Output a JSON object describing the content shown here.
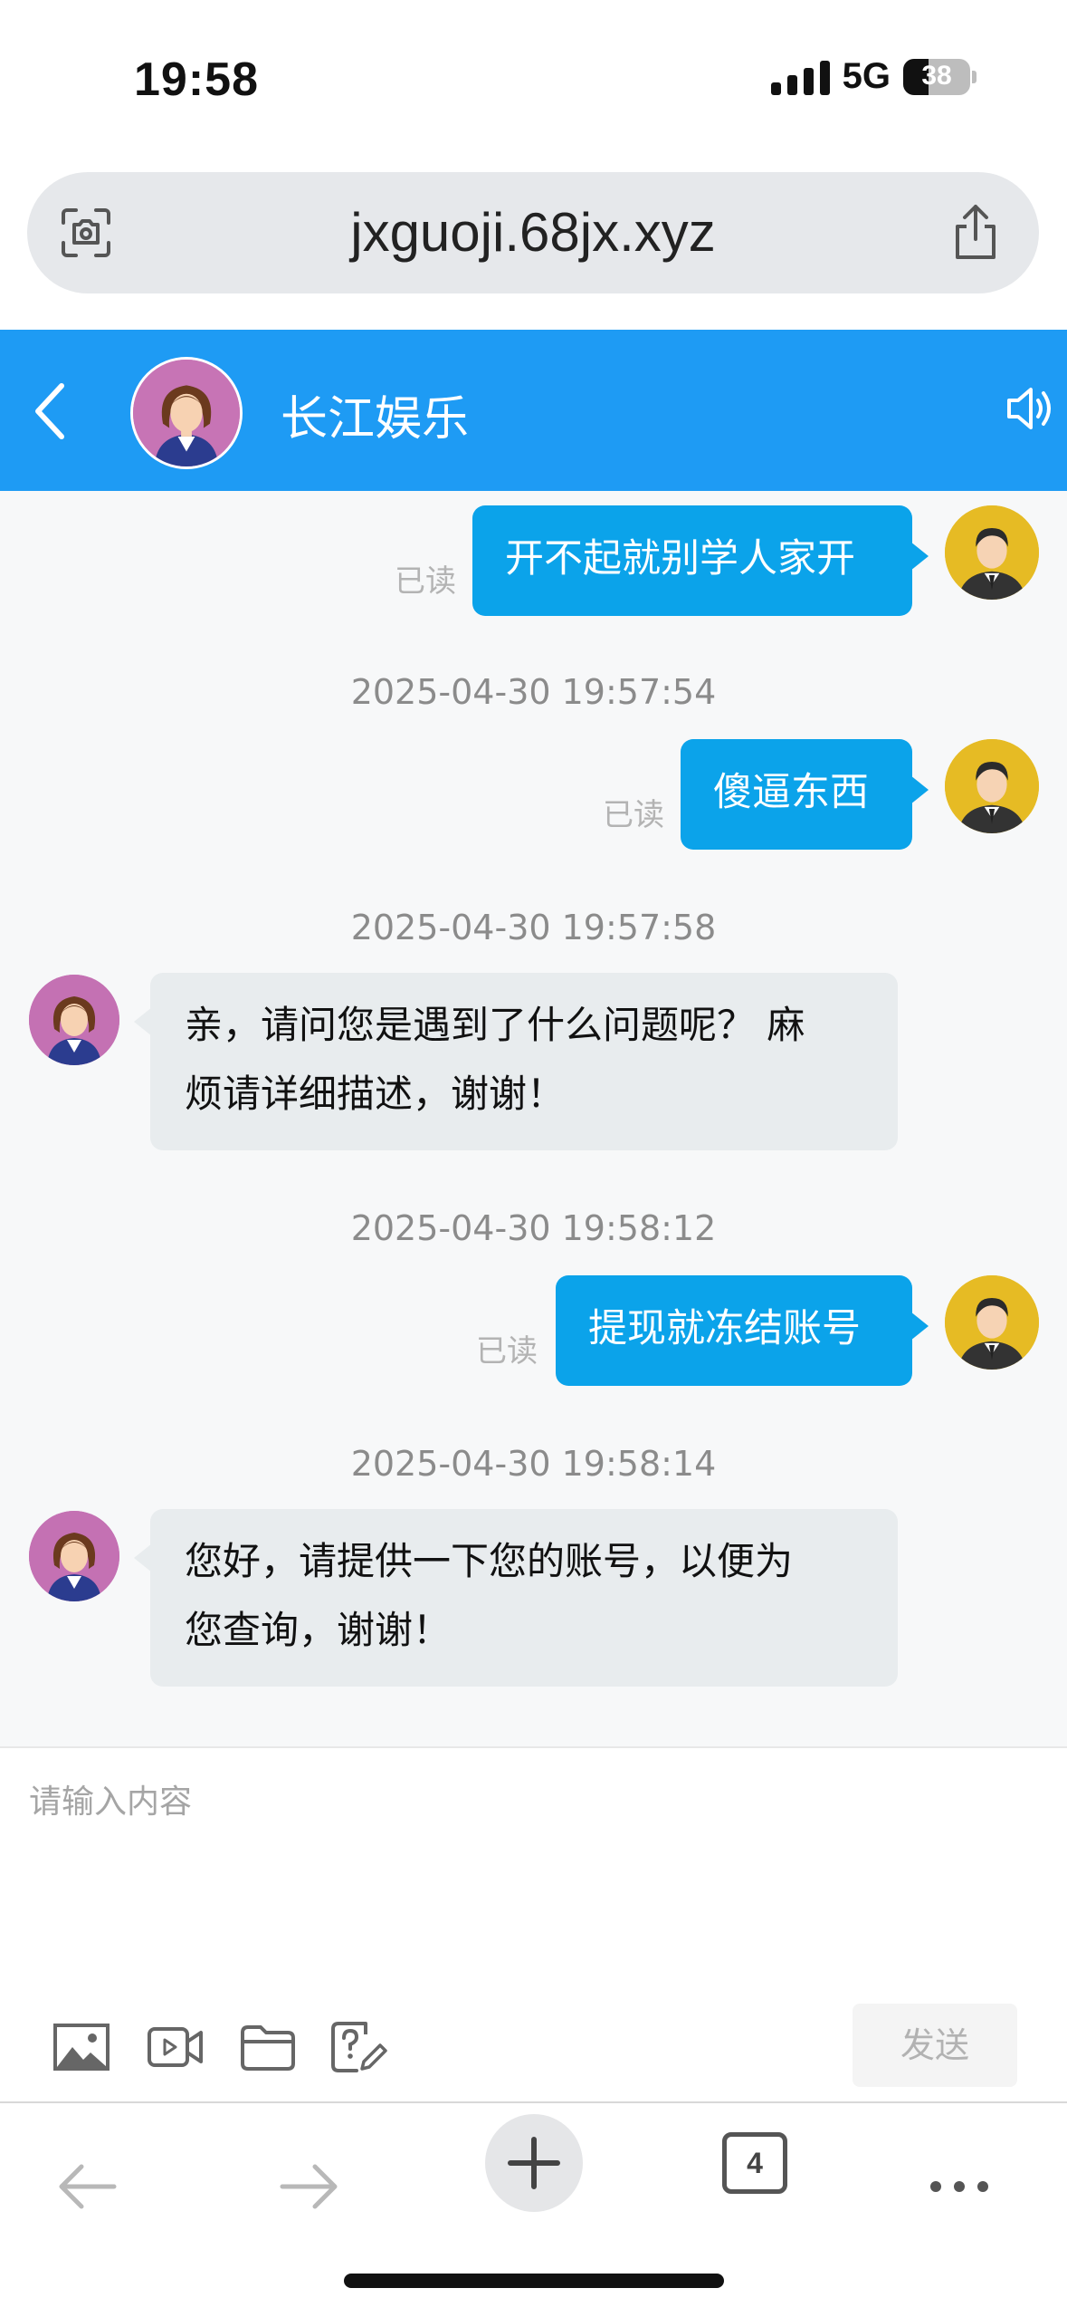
{
  "status_bar": {
    "time": "19:58",
    "network": "5G",
    "battery": "38",
    "battery_level": 0.38
  },
  "browser": {
    "url": "jxguoji.68jx.xyz",
    "tab_count": "4"
  },
  "chat": {
    "title": "长江娱乐",
    "messages": [
      {
        "text": "开不起就别学人家开",
        "status": "已读"
      },
      {
        "timestamp": "2025-04-30 19:57:54",
        "text": "傻逼东西",
        "status": "已读"
      },
      {
        "timestamp": "2025-04-30 19:57:58",
        "text_line1": "亲，请问您是遇到了什么问题呢？ 麻",
        "text_line2": "烦请详细描述，谢谢！"
      },
      {
        "timestamp": "2025-04-30 19:58:12",
        "text": "提现就冻结账号",
        "status": "已读"
      },
      {
        "timestamp": "2025-04-30 19:58:14",
        "text_line1": "您好，请提供一下您的账号，以便为",
        "text_line2": "您查询，谢谢！"
      }
    ]
  },
  "composer": {
    "placeholder": "请输入内容",
    "send_label": "发送",
    "tools": [
      "image-icon",
      "video-icon",
      "folder-icon",
      "feedback-icon"
    ]
  },
  "colors": {
    "header": "#1e9bf4",
    "outgoing_bubble": "#0ba3ea",
    "incoming_bubble": "#e8ecee"
  }
}
